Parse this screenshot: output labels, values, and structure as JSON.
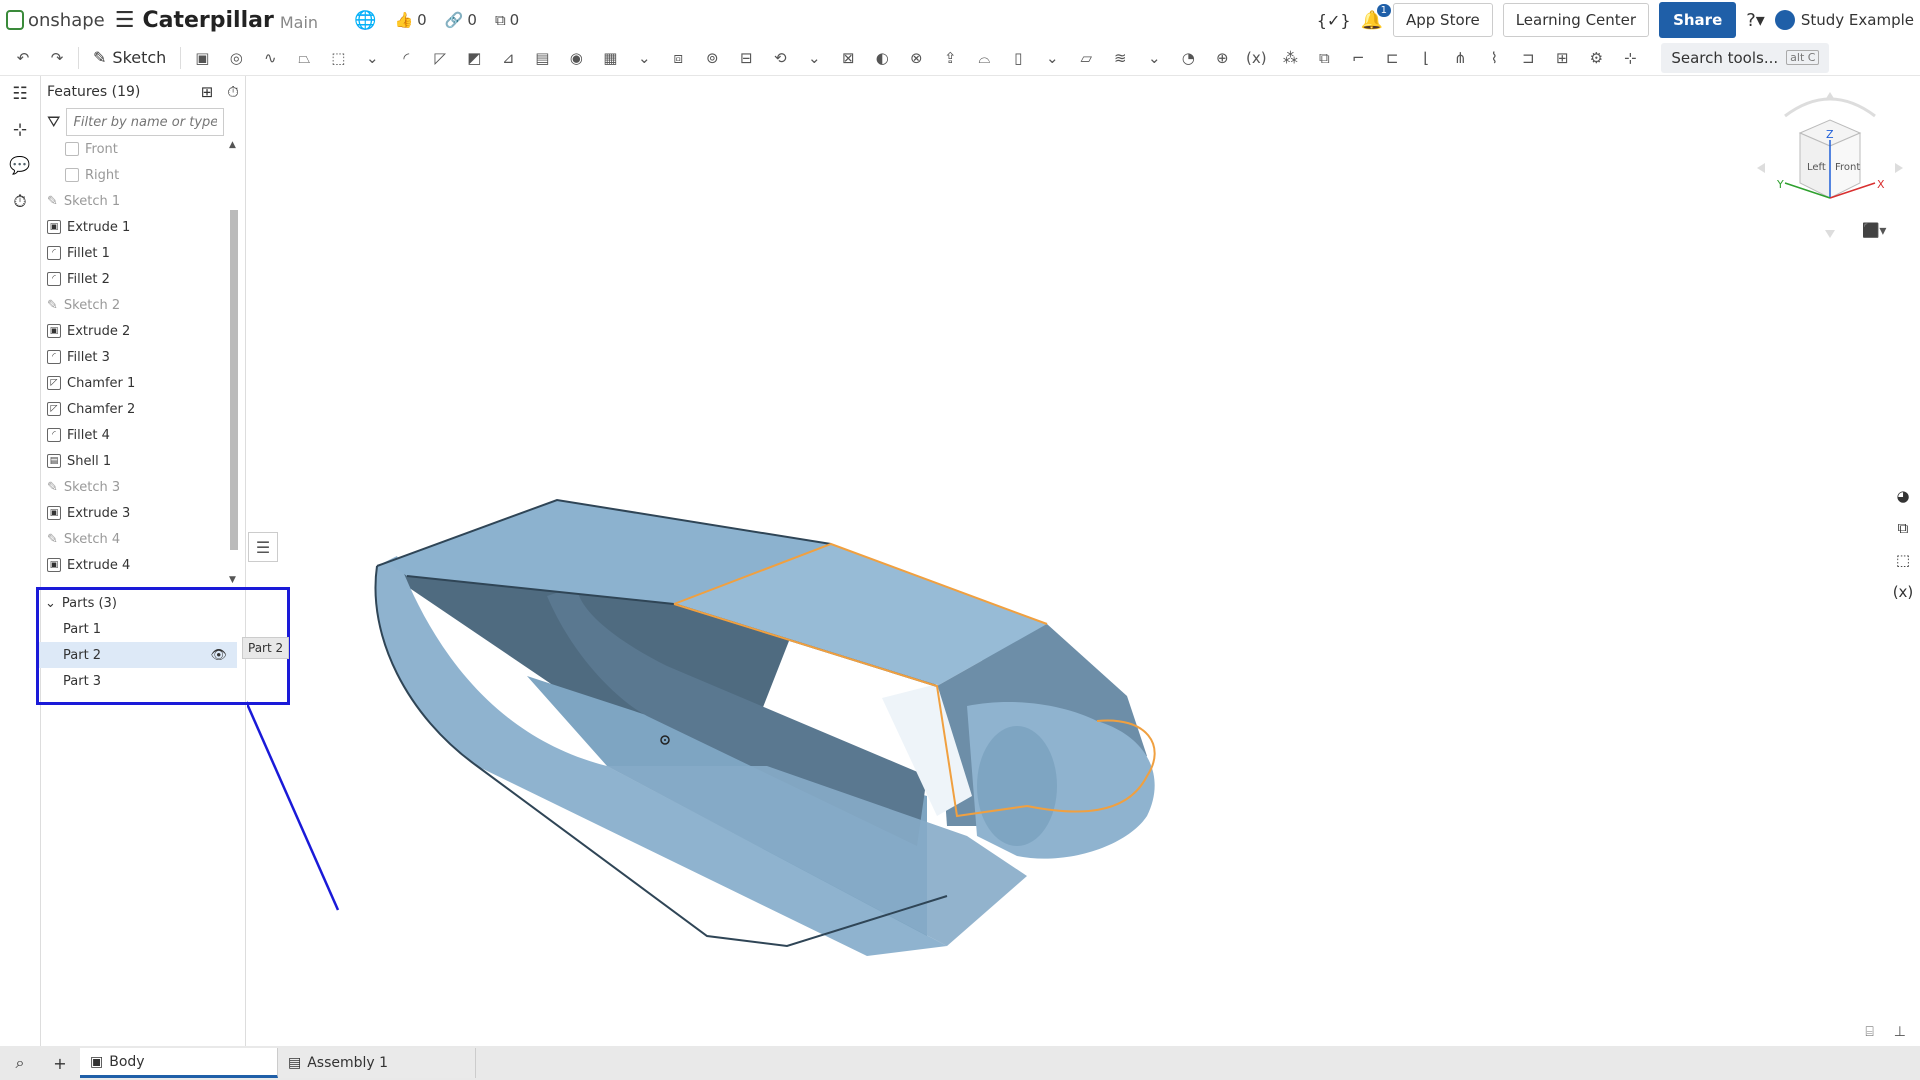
{
  "header": {
    "brand": "onshape",
    "document_title": "Caterpillar",
    "branch": "Main",
    "likes": "0",
    "links": "0",
    "copies": "0",
    "notifications": "1",
    "app_store": "App Store",
    "learning_center": "Learning Center",
    "share": "Share",
    "user": "Study Example"
  },
  "toolbar": {
    "sketch_label": "Sketch",
    "search_placeholder": "Search tools...",
    "search_shortcut": "alt C"
  },
  "features_panel": {
    "title": "Features (19)",
    "filter_placeholder": "Filter by name or type",
    "items": [
      {
        "label": "Front",
        "kind": "plane"
      },
      {
        "label": "Right",
        "kind": "plane"
      },
      {
        "label": "Sketch 1",
        "kind": "sketch"
      },
      {
        "label": "Extrude 1",
        "kind": "feature"
      },
      {
        "label": "Fillet 1",
        "kind": "feature"
      },
      {
        "label": "Fillet 2",
        "kind": "feature"
      },
      {
        "label": "Sketch 2",
        "kind": "sketch"
      },
      {
        "label": "Extrude 2",
        "kind": "feature"
      },
      {
        "label": "Fillet 3",
        "kind": "feature"
      },
      {
        "label": "Chamfer 1",
        "kind": "feature"
      },
      {
        "label": "Chamfer 2",
        "kind": "feature"
      },
      {
        "label": "Fillet 4",
        "kind": "feature"
      },
      {
        "label": "Shell 1",
        "kind": "feature"
      },
      {
        "label": "Sketch 3",
        "kind": "sketch"
      },
      {
        "label": "Extrude 3",
        "kind": "feature"
      },
      {
        "label": "Sketch 4",
        "kind": "sketch"
      },
      {
        "label": "Extrude 4",
        "kind": "feature"
      }
    ]
  },
  "parts_panel": {
    "title": "Parts (3)",
    "items": [
      "Part 1",
      "Part 2",
      "Part 3"
    ],
    "selected": "Part 2",
    "tooltip": "Part 2"
  },
  "viewcube": {
    "face_left": "Left",
    "face_front": "Front",
    "axis_x": "X",
    "axis_y": "Y",
    "axis_z": "Z"
  },
  "bottom_tabs": [
    {
      "label": "Body",
      "active": true
    },
    {
      "label": "Assembly 1",
      "active": false
    }
  ],
  "colors": {
    "accent": "#1f5fa8",
    "highlight_box": "#1a1ad8",
    "model_face": "#8fb3cf",
    "model_dark": "#4f6b80",
    "selection_edge": "#f0a040"
  }
}
